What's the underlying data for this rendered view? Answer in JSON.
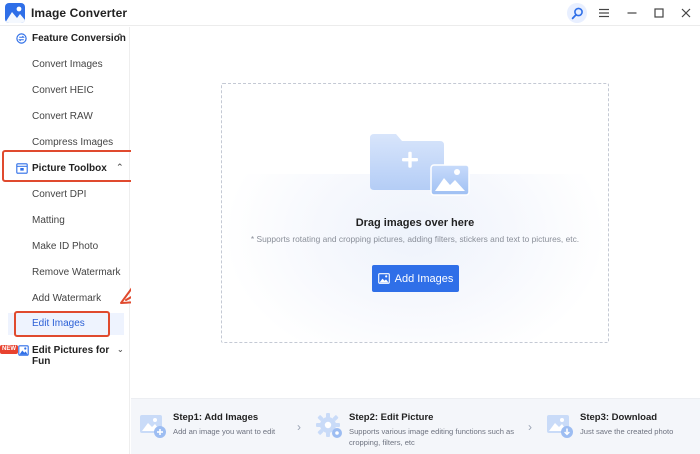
{
  "app": {
    "title": "Image Converter",
    "accent": "#2f6fe8",
    "highlight": "#e04a2e"
  },
  "window_controls": [
    "search-icon",
    "menu-icon",
    "minimize-icon",
    "maximize-icon",
    "close-icon"
  ],
  "sidebar": {
    "feature_conversion": {
      "label": "Feature Conversion",
      "items": [
        "Convert Images",
        "Convert HEIC",
        "Convert RAW",
        "Compress Images"
      ]
    },
    "picture_toolbox": {
      "label": "Picture Toolbox",
      "items": [
        "Convert DPI",
        "Matting",
        "Make ID Photo",
        "Remove Watermark",
        "Add Watermark",
        "Edit Images"
      ]
    },
    "fun": {
      "badge": "NEW",
      "label": "Edit Pictures for Fun"
    }
  },
  "dropzone": {
    "title": "Drag images over here",
    "subtitle": "* Supports rotating and cropping pictures, adding filters, stickers and text to pictures, etc.",
    "button_label": "Add Images"
  },
  "steps": [
    {
      "title": "Step1:  Add Images",
      "desc": "Add an image you want to edit"
    },
    {
      "title": "Step2:  Edit Picture",
      "desc": "Supports various image editing functions such as cropping, filters, etc"
    },
    {
      "title": "Step3:  Download",
      "desc": "Just save the created photo"
    }
  ]
}
